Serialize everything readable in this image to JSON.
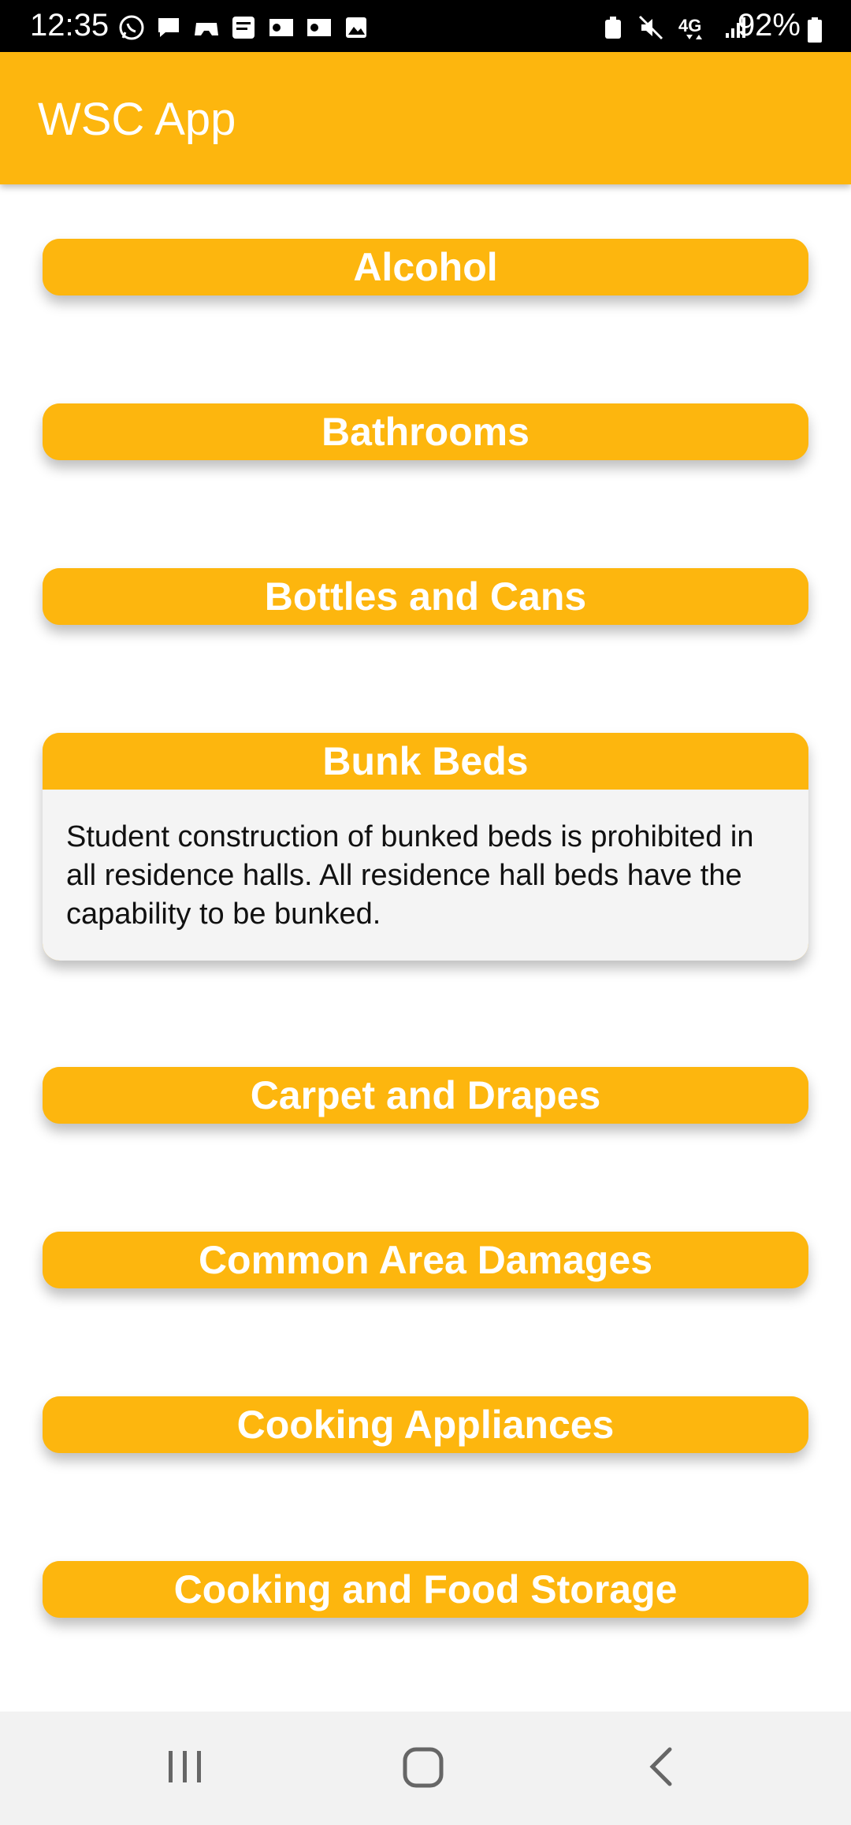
{
  "status_bar": {
    "time": "12:35",
    "battery_percent": "92%",
    "left_icons": [
      "whatsapp-icon",
      "message-icon",
      "gamepad-icon",
      "call-filter-icon",
      "outlook-icon",
      "outlook-icon",
      "image-icon"
    ],
    "right_icons": [
      "recycle-icon",
      "mute-icon",
      "4g-icon",
      "signal-icon",
      "battery-icon"
    ]
  },
  "app_bar": {
    "title": "WSC App"
  },
  "items": [
    {
      "title": "Alcohol",
      "expanded": false
    },
    {
      "title": "Bathrooms",
      "expanded": false
    },
    {
      "title": "Bottles and Cans",
      "expanded": false
    },
    {
      "title": "Bunk Beds",
      "expanded": true,
      "body": "Student construction of bunked beds is prohibited in all residence halls. All residence hall beds have the capability to be bunked."
    },
    {
      "title": "Carpet and Drapes",
      "expanded": false
    },
    {
      "title": "Common Area Damages",
      "expanded": false
    },
    {
      "title": "Cooking Appliances",
      "expanded": false
    },
    {
      "title": "Cooking and Food Storage",
      "expanded": false
    }
  ],
  "nav_bar": {
    "buttons": [
      "recents-icon",
      "home-icon",
      "back-icon"
    ]
  },
  "colors": {
    "accent": "#FDB60E",
    "body_bg": "#f4f4f4"
  }
}
